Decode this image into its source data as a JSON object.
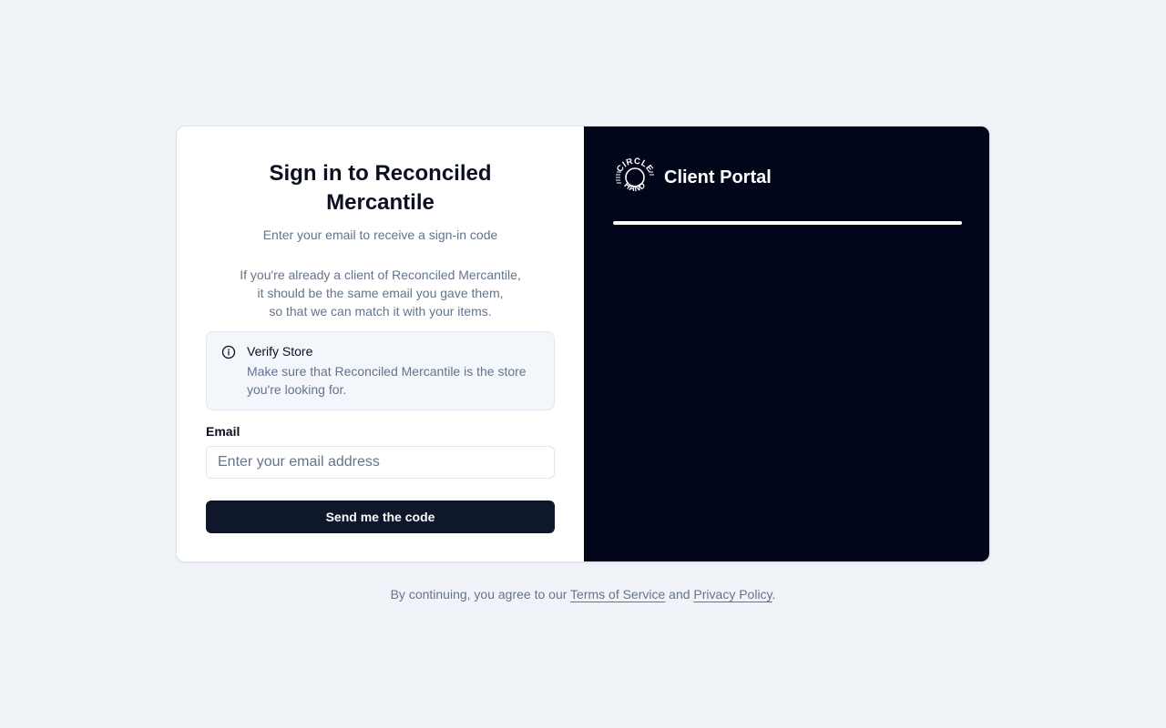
{
  "signin": {
    "title": "Sign in to Reconciled Mercantile",
    "subtitle": "Enter your email to receive a sign-in code",
    "note_lines": [
      "If you're already a client of Reconciled Mercantile,",
      "it should be the same email you gave them,",
      "so that we can match it with your items."
    ],
    "alert": {
      "icon": "info-circle-icon",
      "title": "Verify Store",
      "body": "Make sure that Reconciled Mercantile is the store you're looking for."
    },
    "email": {
      "label": "Email",
      "placeholder": "Enter your email address",
      "value": ""
    },
    "submit_label": "Send me the code"
  },
  "brand_panel": {
    "logo_text": "CIRCLE HAND",
    "logo_icon": "circle-hand-logo-icon",
    "title": "Client Portal"
  },
  "footer": {
    "prefix": "By continuing, you agree to our ",
    "terms_label": "Terms of Service",
    "middle": " and ",
    "privacy_label": "Privacy Policy",
    "suffix": "."
  },
  "colors": {
    "page_background": "#f0f4f9",
    "brand_panel_background": "#02061a",
    "primary_button": "#0f172a",
    "muted_text": "#64748b"
  }
}
